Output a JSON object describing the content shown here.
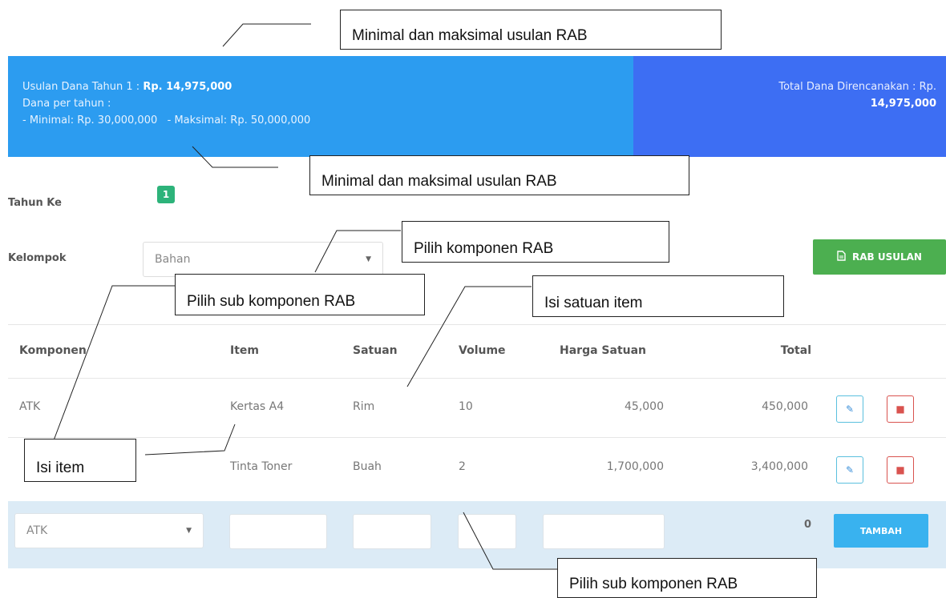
{
  "summary": {
    "usulan_label": "Usulan Dana Tahun 1 :",
    "usulan_value": "Rp. 14,975,000",
    "dana_per_tahun": "Dana per tahun :",
    "min_max": "- Minimal: Rp. 30,000,000   - Maksimal: Rp. 50,000,000",
    "total_label": "Total Dana Direncanakan : Rp.",
    "total_value": "14,975,000"
  },
  "form": {
    "tahun_label": "Tahun Ke",
    "tahun_value": "1",
    "kelompok_label": "Kelompok",
    "kelompok_selected": "Bahan",
    "rab_button": "RAB USULAN"
  },
  "table": {
    "headers": [
      "Komponen",
      "Item",
      "Satuan",
      "Volume",
      "Harga Satuan",
      "Total"
    ],
    "rows": [
      {
        "komponen": "ATK",
        "item": "Kertas A4",
        "satuan": "Rim",
        "volume": "10",
        "harga": "45,000",
        "total": "450,000"
      },
      {
        "komponen": "",
        "item": "Tinta Toner",
        "satuan": "Buah",
        "volume": "2",
        "harga": "1,700,000",
        "total": "3,400,000"
      }
    ],
    "add_row": {
      "komponen_selected": "ATK",
      "total": "0",
      "button": "TAMBAH"
    }
  },
  "annotations": {
    "a1": "Minimal dan maksimal usulan RAB",
    "a2": "Minimal dan maksimal usulan RAB",
    "a3": "Pilih komponen RAB",
    "a4": "Pilih sub komponen RAB",
    "a5": "Isi satuan item",
    "a6": "Isi item",
    "a7": "Pilih sub komponen RAB"
  },
  "icons": {
    "dropdown": "caret-down-icon",
    "rab": "document-icon",
    "edit": "pencil-icon",
    "delete": "trash-icon"
  },
  "colors": {
    "panel_left": "#2c9cf0",
    "panel_right": "#3d6ef3",
    "badge": "#2db37a",
    "green_button": "#4caf50",
    "blue_button": "#39b2ef"
  }
}
